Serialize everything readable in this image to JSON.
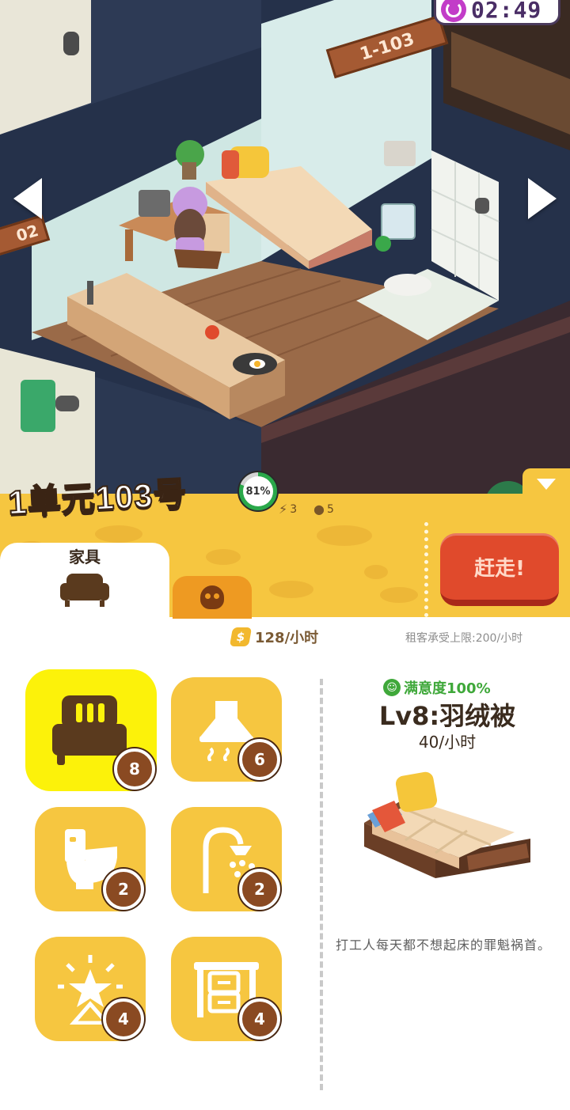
{
  "hud": {
    "timer": "02:49",
    "timer_icon": "clock-icon"
  },
  "scene": {
    "room_sign": "1-103",
    "room_sign_left": "02",
    "nav_left_icon": "arrow-left-icon",
    "nav_right_icon": "arrow-right-icon"
  },
  "room": {
    "title": "1单元103号",
    "satisfaction_ring": "81%",
    "satisfaction_value": 0.81,
    "energy_count": "3",
    "water_count": "5"
  },
  "tabs": [
    {
      "label": "家具",
      "icon": "sofa-icon",
      "selected": true
    },
    {
      "label": "",
      "icon": "skull-icon",
      "selected": false
    }
  ],
  "actions": {
    "evict_label": "赶走!"
  },
  "income": {
    "rate": "128/小时",
    "rent_limit": "租客承受上限:200/小时"
  },
  "furniture": [
    {
      "icon": "bed-icon",
      "level": "8",
      "selected": true
    },
    {
      "icon": "range-hood-icon",
      "level": "6",
      "selected": false
    },
    {
      "icon": "toilet-icon",
      "level": "2",
      "selected": false
    },
    {
      "icon": "shower-icon",
      "level": "2",
      "selected": false
    },
    {
      "icon": "lamp-icon",
      "level": "4",
      "selected": false
    },
    {
      "icon": "desk-icon",
      "level": "4",
      "selected": false
    }
  ],
  "detail": {
    "satisfaction": "满意度100%",
    "name": "Lv8:羽绒被",
    "rate": "40/小时",
    "description": "打工人每天都不想起床的罪魁祸首。"
  },
  "colors": {
    "band_yellow": "#f6c640",
    "card_yellow": "#f6c640",
    "selected_card": "#fcf20a",
    "evict_red": "#e04a2c",
    "badge_brown": "#8a4a22",
    "satisfaction_green": "#3fa83a"
  }
}
